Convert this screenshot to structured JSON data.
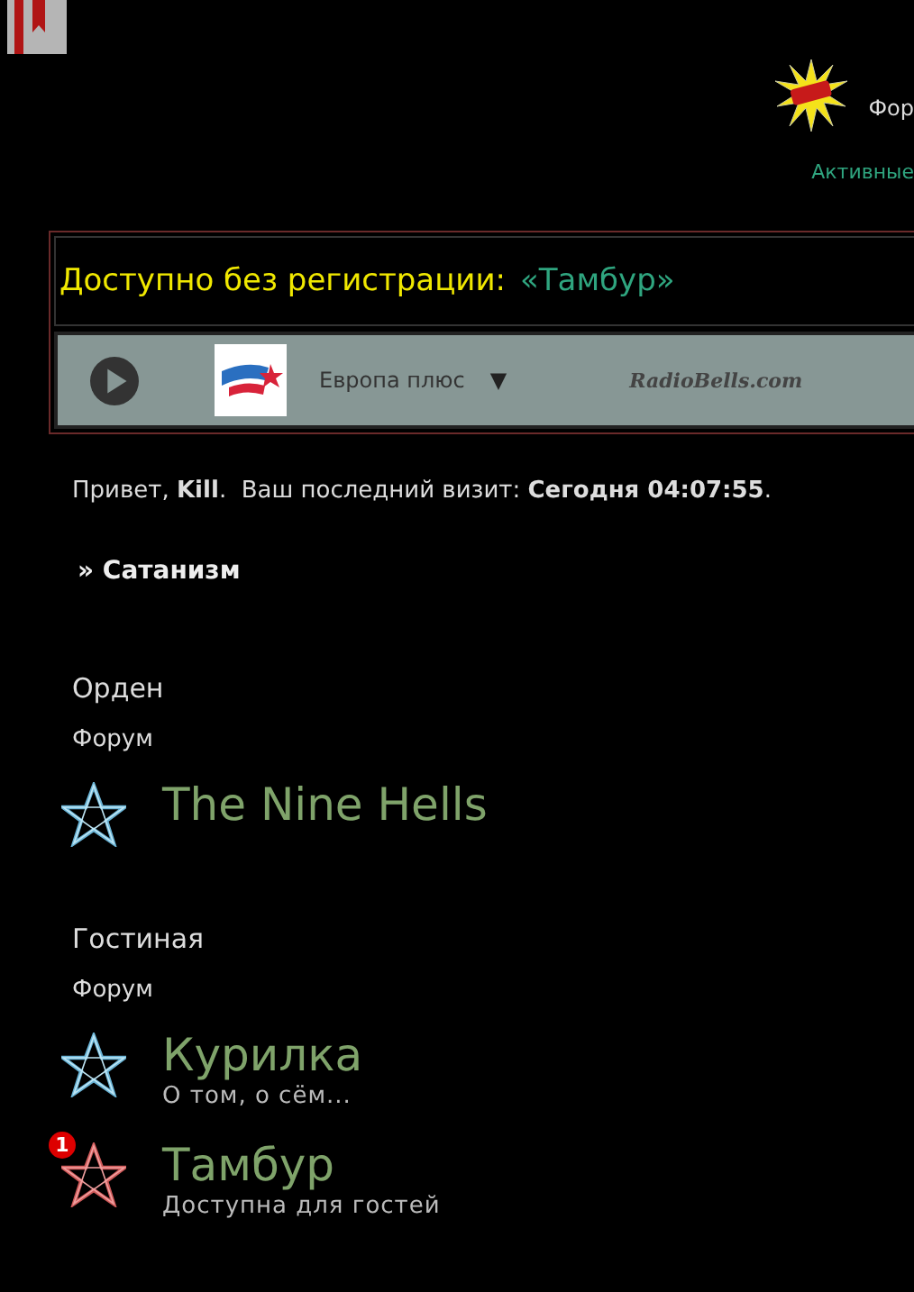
{
  "header": {
    "nav_link": "Фор",
    "active_link": "Активные"
  },
  "notice": {
    "label": "Доступно без регистрации:",
    "link": "«Тамбур»"
  },
  "player": {
    "station": "Европа плюс",
    "dropdown": "▼",
    "brand": "RadioBells.com"
  },
  "welcome": "Привет, **Kill**.  Ваш последний визит: **Сегодня 04:07:55**.",
  "breadcrumb": "» Сатанизм",
  "categories": [
    {
      "title": "Орден",
      "type_label": "Форум",
      "forums": [
        {
          "name": "The Nine Hells",
          "unread": false
        }
      ]
    },
    {
      "title": "Гостиная",
      "type_label": "Форум",
      "forums": [
        {
          "name": "Курилка",
          "description": "О том, о сём...",
          "unread": false
        },
        {
          "name": "Тамбур",
          "description": "Доступна для гостей",
          "unread": true,
          "badge": "1"
        }
      ]
    }
  ]
}
